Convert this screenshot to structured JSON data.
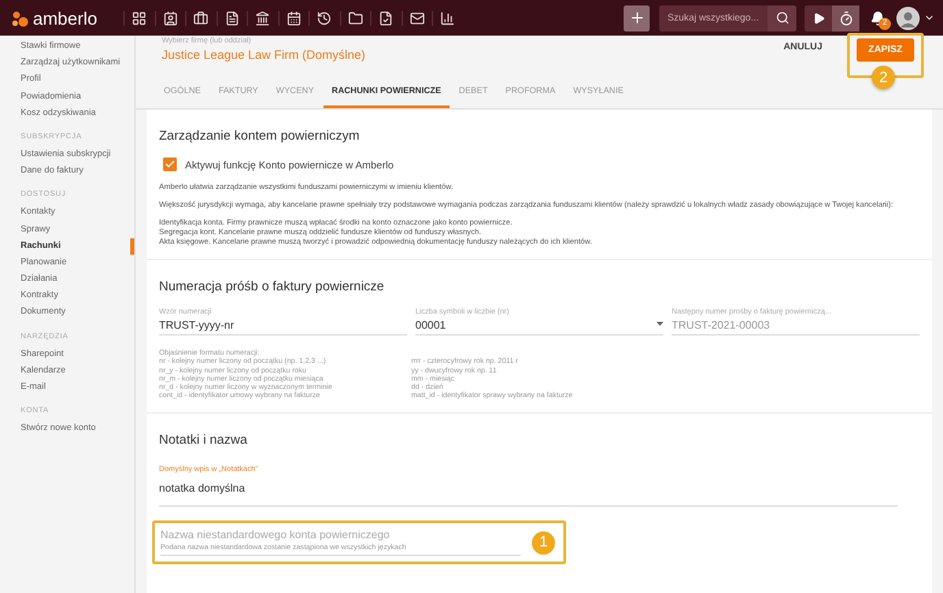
{
  "topbar": {
    "logo": "amberlo",
    "search": {
      "placeholder": "Szukaj wszystkiego..."
    },
    "notifications": "2"
  },
  "sidebar": {
    "sections": [
      {
        "items": [
          {
            "label": "Stawki firmowe",
            "selected": false
          },
          {
            "label": "Zarządzaj użytkownikami",
            "selected": false
          },
          {
            "label": "Profil",
            "selected": false
          },
          {
            "label": "Powiadomienia",
            "selected": false
          },
          {
            "label": "Kosz odzyskiwania",
            "selected": false
          }
        ]
      },
      {
        "title": "SUBSKRYPCJA",
        "items": [
          {
            "label": "Ustawienia subskrypcji",
            "selected": false
          },
          {
            "label": "Dane do faktury",
            "selected": false
          }
        ]
      },
      {
        "title": "DOSTOSUJ",
        "items": [
          {
            "label": "Kontakty",
            "selected": false
          },
          {
            "label": "Sprawy",
            "selected": false
          },
          {
            "label": "Rachunki",
            "selected": true
          },
          {
            "label": "Planowanie",
            "selected": false
          },
          {
            "label": "Działania",
            "selected": false
          },
          {
            "label": "Kontrakty",
            "selected": false
          },
          {
            "label": "Dokumenty",
            "selected": false
          }
        ]
      },
      {
        "title": "NARZĘDZIA",
        "items": [
          {
            "label": "Sharepoint",
            "selected": false
          },
          {
            "label": "Kalendarze",
            "selected": false
          },
          {
            "label": "E-mail",
            "selected": false
          }
        ]
      },
      {
        "title": "KONTA",
        "items": [
          {
            "label": "Stwórz nowe konto",
            "selected": false
          }
        ]
      }
    ]
  },
  "header": {
    "firm_label": "Wybierz firmę (lub oddział)",
    "firm": "Justice League Law Firm (Domyślne)",
    "cancel": "ANULUJ",
    "save": "ZAPISZ"
  },
  "tabs": [
    {
      "label": "OGÓLNE",
      "selected": false
    },
    {
      "label": "FAKTURY",
      "selected": false
    },
    {
      "label": "WYCENY",
      "selected": false
    },
    {
      "label": "RACHUNKI POWIERNICZE",
      "selected": true
    },
    {
      "label": "DEBET",
      "selected": false
    },
    {
      "label": "PROFORMA",
      "selected": false
    },
    {
      "label": "WYSYŁANIE",
      "selected": false
    }
  ],
  "trust": {
    "title": "Zarządzanie kontem powierniczym",
    "checkbox": {
      "label": "Aktywuj funkcję Konto powiernicze w Amberlo",
      "checked": true
    },
    "paragraphs": [
      "Amberlo ułatwia zarządzanie wszystkimi funduszami powierniczymi w imieniu klientów.",
      "Większość jurysdykcji wymaga, aby kancelarie prawne spełniały trzy podstawowe wymagania podczas zarządzania funduszami klientów (należy sprawdzić u lokalnych władz zasady obowiązujące w Twojej kancelarii):"
    ],
    "lines": [
      "Identyfikacja konta. Firmy prawnicze muszą wpłacać środki na konto oznaczone jako konto powiernicze.",
      "Segregacja kont. Kancelarie prawne muszą oddzielić fundusze klientów od funduszy własnych.",
      "Akta księgowe. Kancelarie prawne muszą tworzyć i prowadzić odpowiednią dokumentację funduszy należących do ich klientów."
    ]
  },
  "numbering": {
    "title": "Numeracja próśb o faktury powiernicze",
    "fields": [
      {
        "kind": "text",
        "label": "Wzór numeracji",
        "value": "TRUST-yyyy-nr"
      },
      {
        "kind": "select",
        "label": "Liczba symboli w liczbie (nr)",
        "value": "00001"
      },
      {
        "kind": "readonly",
        "label": "Następny numer prośby o fakturę powierniczą...",
        "value": "TRUST-2021-00003"
      }
    ],
    "legend_title": "Objaśnienie formatu numeracji:",
    "legend_left": [
      "nr - kolejny numer liczony od początku (np. 1,2,3 ...)",
      "nr_y - kolejny numer liczony od początku roku",
      "nr_m - kolejny numer liczony od początku miesiąca",
      "nr_d - kolejny numer liczony w wyznaczonym terminie",
      "cont_id - identyfikator umowy wybrany na fakturze"
    ],
    "legend_right": [
      "rrrr - czterocyfrowy rok np. 2011 r",
      "yy - dwucyfrowy rok np. 11",
      "mm - miesiąc",
      "dd - dzień",
      "matt_id - identyfikator sprawy wybrany na fakturze"
    ]
  },
  "notes": {
    "title": "Notatki i nazwa",
    "note_label": "Domyślny wpis w „Notatkach\"",
    "note_value": "notatka domyślna",
    "name_placeholder": "Nazwa niestandardowego konta powierniczego",
    "name_hint": "Podana nazwa niestandardowa zostanie zastąpiona we wszystkich językach"
  },
  "callouts": [
    "1",
    "2"
  ]
}
